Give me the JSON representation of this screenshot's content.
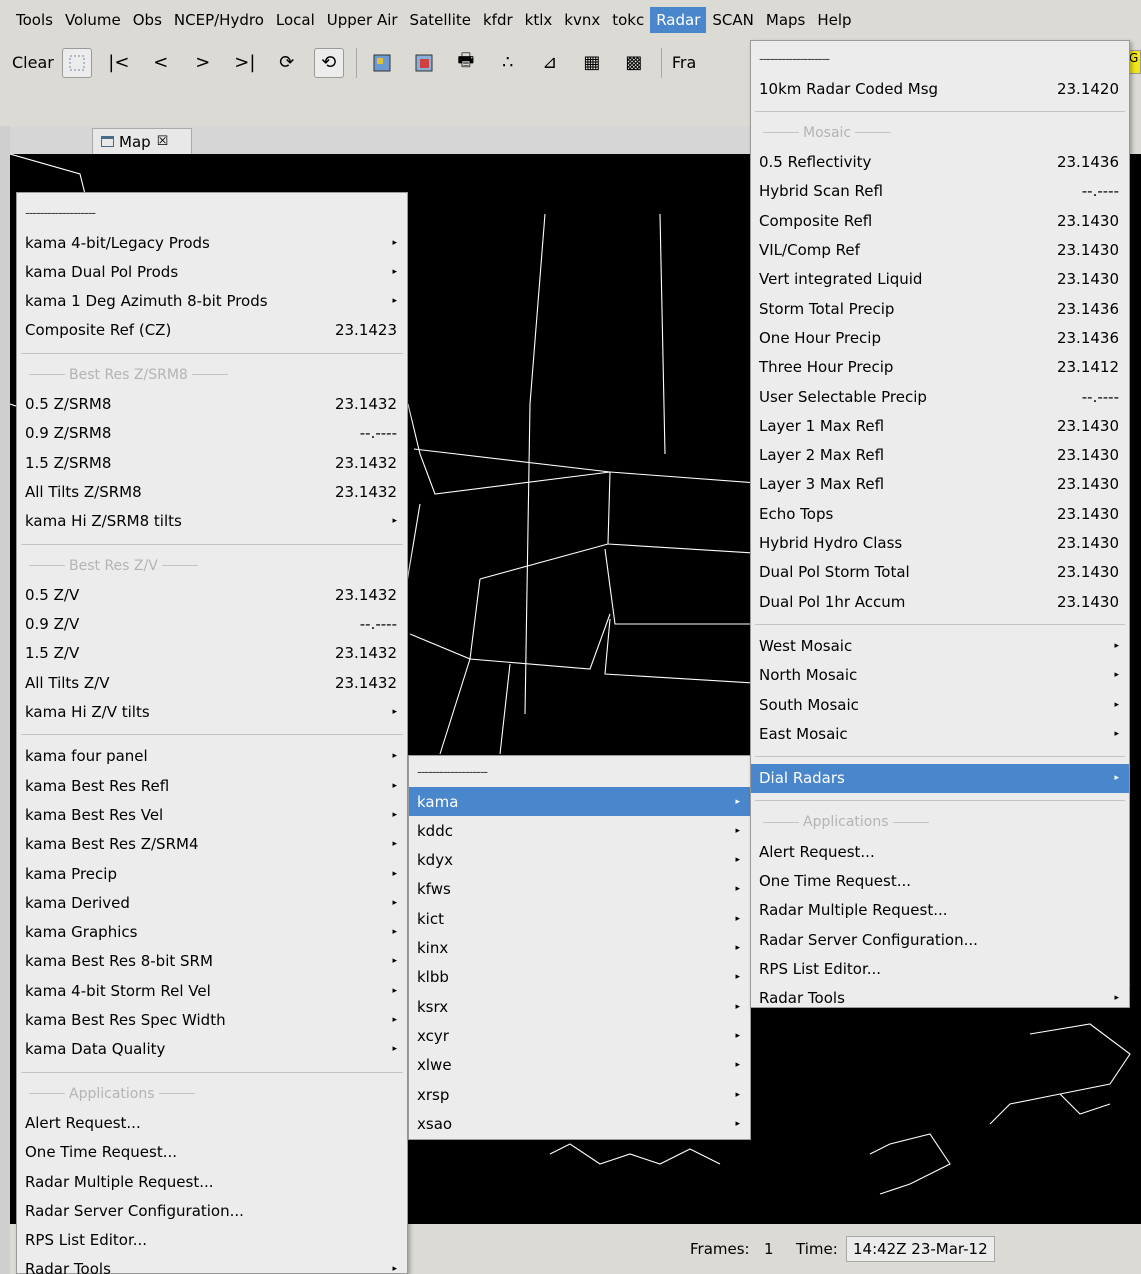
{
  "menubar": [
    {
      "label": "Tools",
      "active": false
    },
    {
      "label": "Volume",
      "active": false
    },
    {
      "label": "Obs",
      "active": false
    },
    {
      "label": "NCEP/Hydro",
      "active": false
    },
    {
      "label": "Local",
      "active": false
    },
    {
      "label": "Upper Air",
      "active": false
    },
    {
      "label": "Satellite",
      "active": false
    },
    {
      "label": "kfdr",
      "active": false
    },
    {
      "label": "ktlx",
      "active": false
    },
    {
      "label": "kvnx",
      "active": false
    },
    {
      "label": "tokc",
      "active": false
    },
    {
      "label": "Radar",
      "active": true
    },
    {
      "label": "SCAN",
      "active": false
    },
    {
      "label": "Maps",
      "active": false
    },
    {
      "label": "Help",
      "active": false
    }
  ],
  "toolbar": {
    "clear_label": "Clear",
    "frames_label": "Fra",
    "yellow_label": "G"
  },
  "map_tab": {
    "label": "Map",
    "close": "☒"
  },
  "status": {
    "frames_label": "Frames:",
    "frames_value": "1",
    "time_label": "Time:",
    "time_value": "14:42Z 23-Mar-12"
  },
  "left_menu": {
    "tearoff": "-------------------",
    "items": [
      {
        "t": "item",
        "label": "kama 4-bit/Legacy Prods",
        "sub": true
      },
      {
        "t": "item",
        "label": "kama Dual Pol Prods",
        "sub": true
      },
      {
        "t": "item",
        "label": "kama 1 Deg Azimuth 8-bit Prods",
        "sub": true
      },
      {
        "t": "item",
        "label": "Composite Ref (CZ)",
        "value": "23.1423"
      },
      {
        "t": "sep"
      },
      {
        "t": "header",
        "label": "Best Res Z/SRM8"
      },
      {
        "t": "item",
        "label": "0.5 Z/SRM8",
        "value": "23.1432"
      },
      {
        "t": "item",
        "label": "0.9 Z/SRM8",
        "value": "--.----"
      },
      {
        "t": "item",
        "label": "1.5 Z/SRM8",
        "value": "23.1432"
      },
      {
        "t": "item",
        "label": "All Tilts Z/SRM8",
        "value": "23.1432"
      },
      {
        "t": "item",
        "label": "kama Hi Z/SRM8 tilts",
        "sub": true
      },
      {
        "t": "sep"
      },
      {
        "t": "header",
        "label": "Best Res Z/V"
      },
      {
        "t": "item",
        "label": "0.5 Z/V",
        "value": "23.1432"
      },
      {
        "t": "item",
        "label": "0.9 Z/V",
        "value": "--.----"
      },
      {
        "t": "item",
        "label": "1.5 Z/V",
        "value": "23.1432"
      },
      {
        "t": "item",
        "label": "All Tilts Z/V",
        "value": "23.1432"
      },
      {
        "t": "item",
        "label": "kama Hi Z/V tilts",
        "sub": true
      },
      {
        "t": "sep"
      },
      {
        "t": "item",
        "label": "kama four panel",
        "sub": true
      },
      {
        "t": "item",
        "label": "kama Best Res Refl",
        "sub": true
      },
      {
        "t": "item",
        "label": "kama Best Res Vel",
        "sub": true
      },
      {
        "t": "item",
        "label": "kama Best Res Z/SRM4",
        "sub": true
      },
      {
        "t": "item",
        "label": "kama Precip",
        "sub": true
      },
      {
        "t": "item",
        "label": "kama Derived",
        "sub": true
      },
      {
        "t": "item",
        "label": "kama Graphics",
        "sub": true
      },
      {
        "t": "item",
        "label": "kama Best Res 8-bit SRM",
        "sub": true
      },
      {
        "t": "item",
        "label": "kama 4-bit Storm Rel Vel",
        "sub": true
      },
      {
        "t": "item",
        "label": "kama Best Res Spec Width",
        "sub": true
      },
      {
        "t": "item",
        "label": "kama Data Quality",
        "sub": true
      },
      {
        "t": "sep"
      },
      {
        "t": "header",
        "label": "Applications"
      },
      {
        "t": "item",
        "label": "Alert Request..."
      },
      {
        "t": "item",
        "label": "One Time Request..."
      },
      {
        "t": "item",
        "label": "Radar Multiple Request..."
      },
      {
        "t": "item",
        "label": "Radar Server Configuration..."
      },
      {
        "t": "item",
        "label": "RPS List Editor..."
      },
      {
        "t": "item",
        "label": "Radar Tools",
        "sub": true
      }
    ]
  },
  "dial_menu": {
    "tearoff": "-------------------",
    "items": [
      {
        "label": "kama",
        "selected": true
      },
      {
        "label": "kddc"
      },
      {
        "label": "kdyx"
      },
      {
        "label": "kfws"
      },
      {
        "label": "kict"
      },
      {
        "label": "kinx"
      },
      {
        "label": "klbb"
      },
      {
        "label": "ksrx"
      },
      {
        "label": "xcyr"
      },
      {
        "label": "xlwe"
      },
      {
        "label": "xrsp"
      },
      {
        "label": "xsao"
      }
    ]
  },
  "radar_menu": {
    "tearoff": "-------------------",
    "items": [
      {
        "t": "item",
        "label": "10km Radar Coded Msg",
        "value": "23.1420"
      },
      {
        "t": "sep"
      },
      {
        "t": "header",
        "label": "Mosaic"
      },
      {
        "t": "item",
        "label": "0.5 Reflectivity",
        "value": "23.1436"
      },
      {
        "t": "item",
        "label": "Hybrid Scan Refl",
        "value": "--.----"
      },
      {
        "t": "item",
        "label": "Composite Refl",
        "value": "23.1430"
      },
      {
        "t": "item",
        "label": "VIL/Comp Ref",
        "value": "23.1430"
      },
      {
        "t": "item",
        "label": "Vert integrated Liquid",
        "value": "23.1430"
      },
      {
        "t": "item",
        "label": "Storm Total Precip",
        "value": "23.1436"
      },
      {
        "t": "item",
        "label": "One Hour Precip",
        "value": "23.1436"
      },
      {
        "t": "item",
        "label": "Three Hour Precip",
        "value": "23.1412"
      },
      {
        "t": "item",
        "label": "User Selectable Precip",
        "value": "--.----"
      },
      {
        "t": "item",
        "label": "Layer 1 Max Refl",
        "value": "23.1430"
      },
      {
        "t": "item",
        "label": "Layer 2 Max Refl",
        "value": "23.1430"
      },
      {
        "t": "item",
        "label": "Layer 3 Max Refl",
        "value": "23.1430"
      },
      {
        "t": "item",
        "label": "Echo Tops",
        "value": "23.1430"
      },
      {
        "t": "item",
        "label": "Hybrid Hydro Class",
        "value": "23.1430"
      },
      {
        "t": "item",
        "label": "Dual Pol Storm Total",
        "value": "23.1430"
      },
      {
        "t": "item",
        "label": "Dual Pol 1hr Accum",
        "value": "23.1430"
      },
      {
        "t": "sep"
      },
      {
        "t": "item",
        "label": "West Mosaic",
        "sub": true
      },
      {
        "t": "item",
        "label": "North Mosaic",
        "sub": true
      },
      {
        "t": "item",
        "label": "South Mosaic",
        "sub": true
      },
      {
        "t": "item",
        "label": "East Mosaic",
        "sub": true
      },
      {
        "t": "sep"
      },
      {
        "t": "item",
        "label": "Dial Radars",
        "sub": true,
        "selected": true
      },
      {
        "t": "sep"
      },
      {
        "t": "header",
        "label": "Applications"
      },
      {
        "t": "item",
        "label": "Alert Request..."
      },
      {
        "t": "item",
        "label": "One Time Request..."
      },
      {
        "t": "item",
        "label": "Radar Multiple Request..."
      },
      {
        "t": "item",
        "label": "Radar Server Configuration..."
      },
      {
        "t": "item",
        "label": "RPS List Editor..."
      },
      {
        "t": "item",
        "label": "Radar Tools",
        "sub": true
      }
    ]
  }
}
